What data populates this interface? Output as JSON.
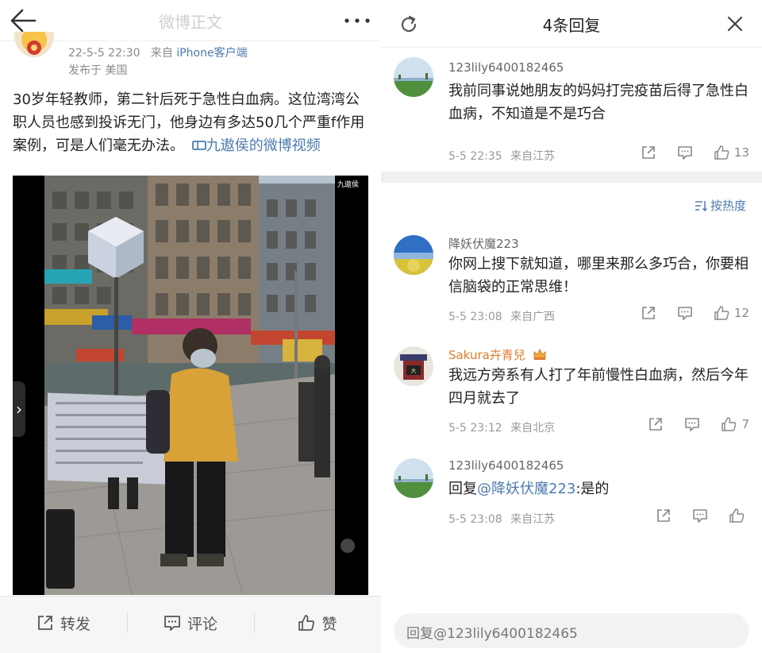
{
  "left": {
    "header": {
      "title": "微博正文",
      "back_icon": "arrow-left-icon",
      "more_icon": "more-dots-icon"
    },
    "post": {
      "date_line": "22-5-5 22:30",
      "source_prefix": "来自",
      "source": "iPhone客户端",
      "location": "发布于 美国",
      "body": "30岁年轻教师，第二针后死于急性白血病。这位湾湾公职人员也感到投诉无门，他身边有多达50几个严重f作用案例，可是人们毫无办法。",
      "video_link_icon": "video-icon",
      "video_link": "九遨侯的微博视频",
      "video_watermark": "九遨侯"
    },
    "footer": {
      "repost_label": "转发",
      "repost_icon": "share-icon",
      "comment_label": "评论",
      "comment_icon": "comment-icon",
      "like_label": "赞",
      "like_icon": "thumbs-up-icon"
    }
  },
  "right": {
    "header": {
      "title": "4条回复",
      "refresh_icon": "refresh-icon",
      "close_icon": "close-icon"
    },
    "sort_label": "按热度",
    "comments": [
      {
        "user": "123lily6400182465",
        "text": "我前同事说她朋友的妈妈打完疫苗后得了急性白血病，不知道是不是巧合",
        "time": "5-5 22:35",
        "from": "来自江苏",
        "likes": "13"
      },
      {
        "user": "降妖伏魔223",
        "text": "你网上搜下就知道，哪里来那么多巧合，你要相信脑袋的正常思维！",
        "time": "5-5 23:08",
        "from": "来自广西",
        "likes": "12"
      },
      {
        "user": "Sakura卉青兒",
        "text": "我远方旁系有人打了年前慢性白血病，然后今年四月就去了",
        "time": "5-5 23:12",
        "from": "来自北京",
        "likes": "7"
      },
      {
        "user": "123lily6400182465",
        "reply_prefix": "回复",
        "mention": "@降妖伏魔223",
        "reply_rest": ":是的",
        "time": "5-5 23:08",
        "from": "来自江苏",
        "likes": ""
      }
    ],
    "reply_placeholder": "回复@123lily6400182465"
  }
}
